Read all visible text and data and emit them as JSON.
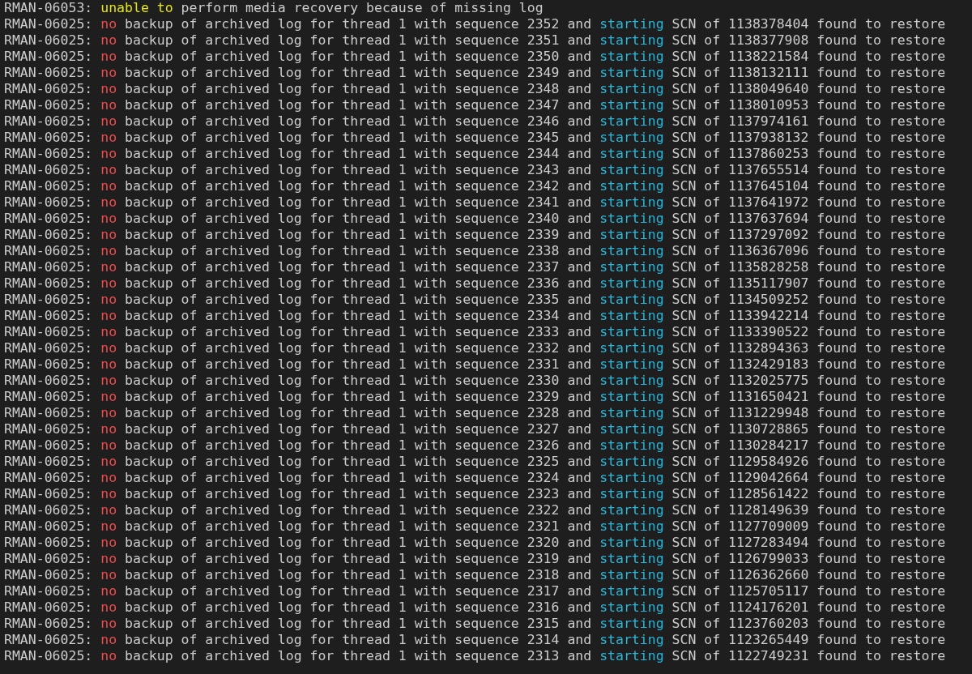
{
  "terminal": {
    "lines": [
      {
        "segments": [
          {
            "kind": "plain",
            "text": "RMAN-06053: "
          },
          {
            "kind": "warning",
            "text": "unable to"
          },
          {
            "kind": "plain",
            "text": " perform media recovery because of missing log"
          }
        ]
      },
      {
        "segments": [
          {
            "kind": "plain",
            "text": "RMAN-06025: "
          },
          {
            "kind": "error",
            "text": "no"
          },
          {
            "kind": "plain",
            "text": " backup of archived log for thread 1 with sequence 2352 and "
          },
          {
            "kind": "info",
            "text": "starting"
          },
          {
            "kind": "plain",
            "text": " SCN of 1138378404 found to restore"
          }
        ]
      },
      {
        "segments": [
          {
            "kind": "plain",
            "text": "RMAN-06025: "
          },
          {
            "kind": "error",
            "text": "no"
          },
          {
            "kind": "plain",
            "text": " backup of archived log for thread 1 with sequence 2351 and "
          },
          {
            "kind": "info",
            "text": "starting"
          },
          {
            "kind": "plain",
            "text": " SCN of 1138377908 found to restore"
          }
        ]
      },
      {
        "segments": [
          {
            "kind": "plain",
            "text": "RMAN-06025: "
          },
          {
            "kind": "error",
            "text": "no"
          },
          {
            "kind": "plain",
            "text": " backup of archived log for thread 1 with sequence 2350 and "
          },
          {
            "kind": "info",
            "text": "starting"
          },
          {
            "kind": "plain",
            "text": " SCN of 1138221584 found to restore"
          }
        ]
      },
      {
        "segments": [
          {
            "kind": "plain",
            "text": "RMAN-06025: "
          },
          {
            "kind": "error",
            "text": "no"
          },
          {
            "kind": "plain",
            "text": " backup of archived log for thread 1 with sequence 2349 and "
          },
          {
            "kind": "info",
            "text": "starting"
          },
          {
            "kind": "plain",
            "text": " SCN of 1138132111 found to restore"
          }
        ]
      },
      {
        "segments": [
          {
            "kind": "plain",
            "text": "RMAN-06025: "
          },
          {
            "kind": "error",
            "text": "no"
          },
          {
            "kind": "plain",
            "text": " backup of archived log for thread 1 with sequence 2348 and "
          },
          {
            "kind": "info",
            "text": "starting"
          },
          {
            "kind": "plain",
            "text": " SCN of 1138049640 found to restore"
          }
        ]
      },
      {
        "segments": [
          {
            "kind": "plain",
            "text": "RMAN-06025: "
          },
          {
            "kind": "error",
            "text": "no"
          },
          {
            "kind": "plain",
            "text": " backup of archived log for thread 1 with sequence 2347 and "
          },
          {
            "kind": "info",
            "text": "starting"
          },
          {
            "kind": "plain",
            "text": " SCN of 1138010953 found to restore"
          }
        ]
      },
      {
        "segments": [
          {
            "kind": "plain",
            "text": "RMAN-06025: "
          },
          {
            "kind": "error",
            "text": "no"
          },
          {
            "kind": "plain",
            "text": " backup of archived log for thread 1 with sequence 2346 and "
          },
          {
            "kind": "info",
            "text": "starting"
          },
          {
            "kind": "plain",
            "text": " SCN of 1137974161 found to restore"
          }
        ]
      },
      {
        "segments": [
          {
            "kind": "plain",
            "text": "RMAN-06025: "
          },
          {
            "kind": "error",
            "text": "no"
          },
          {
            "kind": "plain",
            "text": " backup of archived log for thread 1 with sequence 2345 and "
          },
          {
            "kind": "info",
            "text": "starting"
          },
          {
            "kind": "plain",
            "text": " SCN of 1137938132 found to restore"
          }
        ]
      },
      {
        "segments": [
          {
            "kind": "plain",
            "text": "RMAN-06025: "
          },
          {
            "kind": "error",
            "text": "no"
          },
          {
            "kind": "plain",
            "text": " backup of archived log for thread 1 with sequence 2344 and "
          },
          {
            "kind": "info",
            "text": "starting"
          },
          {
            "kind": "plain",
            "text": " SCN of 1137860253 found to restore"
          }
        ]
      },
      {
        "segments": [
          {
            "kind": "plain",
            "text": "RMAN-06025: "
          },
          {
            "kind": "error",
            "text": "no"
          },
          {
            "kind": "plain",
            "text": " backup of archived log for thread 1 with sequence 2343 and "
          },
          {
            "kind": "info",
            "text": "starting"
          },
          {
            "kind": "plain",
            "text": " SCN of 1137655514 found to restore"
          }
        ]
      },
      {
        "segments": [
          {
            "kind": "plain",
            "text": "RMAN-06025: "
          },
          {
            "kind": "error",
            "text": "no"
          },
          {
            "kind": "plain",
            "text": " backup of archived log for thread 1 with sequence 2342 and "
          },
          {
            "kind": "info",
            "text": "starting"
          },
          {
            "kind": "plain",
            "text": " SCN of 1137645104 found to restore"
          }
        ]
      },
      {
        "segments": [
          {
            "kind": "plain",
            "text": "RMAN-06025: "
          },
          {
            "kind": "error",
            "text": "no"
          },
          {
            "kind": "plain",
            "text": " backup of archived log for thread 1 with sequence 2341 and "
          },
          {
            "kind": "info",
            "text": "starting"
          },
          {
            "kind": "plain",
            "text": " SCN of 1137641972 found to restore"
          }
        ]
      },
      {
        "segments": [
          {
            "kind": "plain",
            "text": "RMAN-06025: "
          },
          {
            "kind": "error",
            "text": "no"
          },
          {
            "kind": "plain",
            "text": " backup of archived log for thread 1 with sequence 2340 and "
          },
          {
            "kind": "info",
            "text": "starting"
          },
          {
            "kind": "plain",
            "text": " SCN of 1137637694 found to restore"
          }
        ]
      },
      {
        "segments": [
          {
            "kind": "plain",
            "text": "RMAN-06025: "
          },
          {
            "kind": "error",
            "text": "no"
          },
          {
            "kind": "plain",
            "text": " backup of archived log for thread 1 with sequence 2339 and "
          },
          {
            "kind": "info",
            "text": "starting"
          },
          {
            "kind": "plain",
            "text": " SCN of 1137297092 found to restore"
          }
        ]
      },
      {
        "segments": [
          {
            "kind": "plain",
            "text": "RMAN-06025: "
          },
          {
            "kind": "error",
            "text": "no"
          },
          {
            "kind": "plain",
            "text": " backup of archived log for thread 1 with sequence 2338 and "
          },
          {
            "kind": "info",
            "text": "starting"
          },
          {
            "kind": "plain",
            "text": " SCN of 1136367096 found to restore"
          }
        ]
      },
      {
        "segments": [
          {
            "kind": "plain",
            "text": "RMAN-06025: "
          },
          {
            "kind": "error",
            "text": "no"
          },
          {
            "kind": "plain",
            "text": " backup of archived log for thread 1 with sequence 2337 and "
          },
          {
            "kind": "info",
            "text": "starting"
          },
          {
            "kind": "plain",
            "text": " SCN of 1135828258 found to restore"
          }
        ]
      },
      {
        "segments": [
          {
            "kind": "plain",
            "text": "RMAN-06025: "
          },
          {
            "kind": "error",
            "text": "no"
          },
          {
            "kind": "plain",
            "text": " backup of archived log for thread 1 with sequence 2336 and "
          },
          {
            "kind": "info",
            "text": "starting"
          },
          {
            "kind": "plain",
            "text": " SCN of 1135117907 found to restore"
          }
        ]
      },
      {
        "segments": [
          {
            "kind": "plain",
            "text": "RMAN-06025: "
          },
          {
            "kind": "error",
            "text": "no"
          },
          {
            "kind": "plain",
            "text": " backup of archived log for thread 1 with sequence 2335 and "
          },
          {
            "kind": "info",
            "text": "starting"
          },
          {
            "kind": "plain",
            "text": " SCN of 1134509252 found to restore"
          }
        ]
      },
      {
        "segments": [
          {
            "kind": "plain",
            "text": "RMAN-06025: "
          },
          {
            "kind": "error",
            "text": "no"
          },
          {
            "kind": "plain",
            "text": " backup of archived log for thread 1 with sequence 2334 and "
          },
          {
            "kind": "info",
            "text": "starting"
          },
          {
            "kind": "plain",
            "text": " SCN of 1133942214 found to restore"
          }
        ]
      },
      {
        "segments": [
          {
            "kind": "plain",
            "text": "RMAN-06025: "
          },
          {
            "kind": "error",
            "text": "no"
          },
          {
            "kind": "plain",
            "text": " backup of archived log for thread 1 with sequence 2333 and "
          },
          {
            "kind": "info",
            "text": "starting"
          },
          {
            "kind": "plain",
            "text": " SCN of 1133390522 found to restore"
          }
        ]
      },
      {
        "segments": [
          {
            "kind": "plain",
            "text": "RMAN-06025: "
          },
          {
            "kind": "error",
            "text": "no"
          },
          {
            "kind": "plain",
            "text": " backup of archived log for thread 1 with sequence 2332 and "
          },
          {
            "kind": "info",
            "text": "starting"
          },
          {
            "kind": "plain",
            "text": " SCN of 1132894363 found to restore"
          }
        ]
      },
      {
        "segments": [
          {
            "kind": "plain",
            "text": "RMAN-06025: "
          },
          {
            "kind": "error",
            "text": "no"
          },
          {
            "kind": "plain",
            "text": " backup of archived log for thread 1 with sequence 2331 and "
          },
          {
            "kind": "info",
            "text": "starting"
          },
          {
            "kind": "plain",
            "text": " SCN of 1132429183 found to restore"
          }
        ]
      },
      {
        "segments": [
          {
            "kind": "plain",
            "text": "RMAN-06025: "
          },
          {
            "kind": "error",
            "text": "no"
          },
          {
            "kind": "plain",
            "text": " backup of archived log for thread 1 with sequence 2330 and "
          },
          {
            "kind": "info",
            "text": "starting"
          },
          {
            "kind": "plain",
            "text": " SCN of 1132025775 found to restore"
          }
        ]
      },
      {
        "segments": [
          {
            "kind": "plain",
            "text": "RMAN-06025: "
          },
          {
            "kind": "error",
            "text": "no"
          },
          {
            "kind": "plain",
            "text": " backup of archived log for thread 1 with sequence 2329 and "
          },
          {
            "kind": "info",
            "text": "starting"
          },
          {
            "kind": "plain",
            "text": " SCN of 1131650421 found to restore"
          }
        ]
      },
      {
        "segments": [
          {
            "kind": "plain",
            "text": "RMAN-06025: "
          },
          {
            "kind": "error",
            "text": "no"
          },
          {
            "kind": "plain",
            "text": " backup of archived log for thread 1 with sequence 2328 and "
          },
          {
            "kind": "info",
            "text": "starting"
          },
          {
            "kind": "plain",
            "text": " SCN of 1131229948 found to restore"
          }
        ]
      },
      {
        "segments": [
          {
            "kind": "plain",
            "text": "RMAN-06025: "
          },
          {
            "kind": "error",
            "text": "no"
          },
          {
            "kind": "plain",
            "text": " backup of archived log for thread 1 with sequence 2327 and "
          },
          {
            "kind": "info",
            "text": "starting"
          },
          {
            "kind": "plain",
            "text": " SCN of 1130728865 found to restore"
          }
        ]
      },
      {
        "segments": [
          {
            "kind": "plain",
            "text": "RMAN-06025: "
          },
          {
            "kind": "error",
            "text": "no"
          },
          {
            "kind": "plain",
            "text": " backup of archived log for thread 1 with sequence 2326 and "
          },
          {
            "kind": "info",
            "text": "starting"
          },
          {
            "kind": "plain",
            "text": " SCN of 1130284217 found to restore"
          }
        ]
      },
      {
        "segments": [
          {
            "kind": "plain",
            "text": "RMAN-06025: "
          },
          {
            "kind": "error",
            "text": "no"
          },
          {
            "kind": "plain",
            "text": " backup of archived log for thread 1 with sequence 2325 and "
          },
          {
            "kind": "info",
            "text": "starting"
          },
          {
            "kind": "plain",
            "text": " SCN of 1129584926 found to restore"
          }
        ]
      },
      {
        "segments": [
          {
            "kind": "plain",
            "text": "RMAN-06025: "
          },
          {
            "kind": "error",
            "text": "no"
          },
          {
            "kind": "plain",
            "text": " backup of archived log for thread 1 with sequence 2324 and "
          },
          {
            "kind": "info",
            "text": "starting"
          },
          {
            "kind": "plain",
            "text": " SCN of 1129042664 found to restore"
          }
        ]
      },
      {
        "segments": [
          {
            "kind": "plain",
            "text": "RMAN-06025: "
          },
          {
            "kind": "error",
            "text": "no"
          },
          {
            "kind": "plain",
            "text": " backup of archived log for thread 1 with sequence 2323 and "
          },
          {
            "kind": "info",
            "text": "starting"
          },
          {
            "kind": "plain",
            "text": " SCN of 1128561422 found to restore"
          }
        ]
      },
      {
        "segments": [
          {
            "kind": "plain",
            "text": "RMAN-06025: "
          },
          {
            "kind": "error",
            "text": "no"
          },
          {
            "kind": "plain",
            "text": " backup of archived log for thread 1 with sequence 2322 and "
          },
          {
            "kind": "info",
            "text": "starting"
          },
          {
            "kind": "plain",
            "text": " SCN of 1128149639 found to restore"
          }
        ]
      },
      {
        "segments": [
          {
            "kind": "plain",
            "text": "RMAN-06025: "
          },
          {
            "kind": "error",
            "text": "no"
          },
          {
            "kind": "plain",
            "text": " backup of archived log for thread 1 with sequence 2321 and "
          },
          {
            "kind": "info",
            "text": "starting"
          },
          {
            "kind": "plain",
            "text": " SCN of 1127709009 found to restore"
          }
        ]
      },
      {
        "segments": [
          {
            "kind": "plain",
            "text": "RMAN-06025: "
          },
          {
            "kind": "error",
            "text": "no"
          },
          {
            "kind": "plain",
            "text": " backup of archived log for thread 1 with sequence 2320 and "
          },
          {
            "kind": "info",
            "text": "starting"
          },
          {
            "kind": "plain",
            "text": " SCN of 1127283494 found to restore"
          }
        ]
      },
      {
        "segments": [
          {
            "kind": "plain",
            "text": "RMAN-06025: "
          },
          {
            "kind": "error",
            "text": "no"
          },
          {
            "kind": "plain",
            "text": " backup of archived log for thread 1 with sequence 2319 and "
          },
          {
            "kind": "info",
            "text": "starting"
          },
          {
            "kind": "plain",
            "text": " SCN of 1126799033 found to restore"
          }
        ]
      },
      {
        "segments": [
          {
            "kind": "plain",
            "text": "RMAN-06025: "
          },
          {
            "kind": "error",
            "text": "no"
          },
          {
            "kind": "plain",
            "text": " backup of archived log for thread 1 with sequence 2318 and "
          },
          {
            "kind": "info",
            "text": "starting"
          },
          {
            "kind": "plain",
            "text": " SCN of 1126362660 found to restore"
          }
        ]
      },
      {
        "segments": [
          {
            "kind": "plain",
            "text": "RMAN-06025: "
          },
          {
            "kind": "error",
            "text": "no"
          },
          {
            "kind": "plain",
            "text": " backup of archived log for thread 1 with sequence 2317 and "
          },
          {
            "kind": "info",
            "text": "starting"
          },
          {
            "kind": "plain",
            "text": " SCN of 1125705117 found to restore"
          }
        ]
      },
      {
        "segments": [
          {
            "kind": "plain",
            "text": "RMAN-06025: "
          },
          {
            "kind": "error",
            "text": "no"
          },
          {
            "kind": "plain",
            "text": " backup of archived log for thread 1 with sequence 2316 and "
          },
          {
            "kind": "info",
            "text": "starting"
          },
          {
            "kind": "plain",
            "text": " SCN of 1124176201 found to restore"
          }
        ]
      },
      {
        "segments": [
          {
            "kind": "plain",
            "text": "RMAN-06025: "
          },
          {
            "kind": "error",
            "text": "no"
          },
          {
            "kind": "plain",
            "text": " backup of archived log for thread 1 with sequence 2315 and "
          },
          {
            "kind": "info",
            "text": "starting"
          },
          {
            "kind": "plain",
            "text": " SCN of 1123760203 found to restore"
          }
        ]
      },
      {
        "segments": [
          {
            "kind": "plain",
            "text": "RMAN-06025: "
          },
          {
            "kind": "error",
            "text": "no"
          },
          {
            "kind": "plain",
            "text": " backup of archived log for thread 1 with sequence 2314 and "
          },
          {
            "kind": "info",
            "text": "starting"
          },
          {
            "kind": "plain",
            "text": " SCN of 1123265449 found to restore"
          }
        ]
      },
      {
        "segments": [
          {
            "kind": "plain",
            "text": "RMAN-06025: "
          },
          {
            "kind": "error",
            "text": "no"
          },
          {
            "kind": "plain",
            "text": " backup of archived log for thread 1 with sequence 2313 and "
          },
          {
            "kind": "info",
            "text": "starting"
          },
          {
            "kind": "plain",
            "text": " SCN of 1122749231 found to restore"
          }
        ]
      }
    ]
  }
}
